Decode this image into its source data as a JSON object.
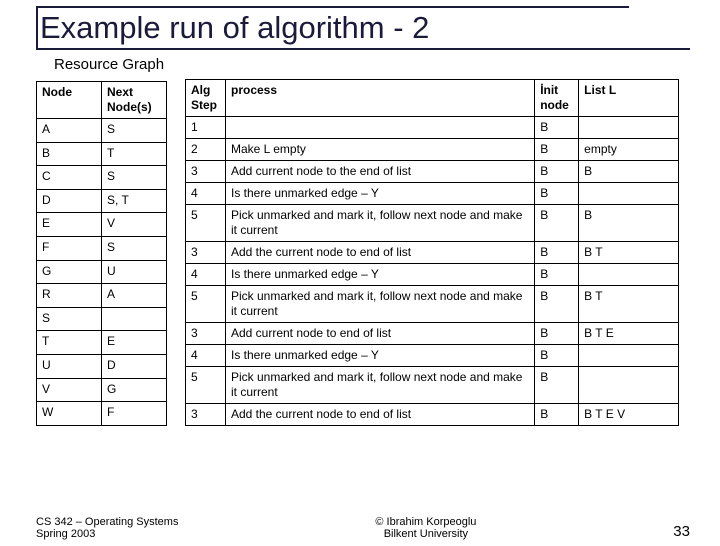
{
  "title": "Example run of algorithm - 2",
  "subtitle": "Resource Graph",
  "graph_headers": [
    "Node",
    "Next Node(s)"
  ],
  "graph_rows": [
    [
      "A",
      "S"
    ],
    [
      "B",
      "T"
    ],
    [
      "C",
      "S"
    ],
    [
      "D",
      "S, T"
    ],
    [
      "E",
      "V"
    ],
    [
      "F",
      "S"
    ],
    [
      "G",
      "U"
    ],
    [
      "R",
      "A"
    ],
    [
      "S",
      ""
    ],
    [
      "T",
      "E"
    ],
    [
      "U",
      "D"
    ],
    [
      "V",
      "G"
    ],
    [
      "W",
      "F"
    ]
  ],
  "alg_headers": [
    "Alg Step",
    "process",
    "İnit node",
    "List L"
  ],
  "alg_rows": [
    [
      "1",
      "",
      "B",
      ""
    ],
    [
      "2",
      "Make L empty",
      "B",
      "empty"
    ],
    [
      "3",
      "Add current node to the end of list",
      "B",
      "B"
    ],
    [
      "4",
      "Is there unmarked edge – Y",
      "B",
      ""
    ],
    [
      "5",
      "Pick unmarked and mark it, follow next node and make it current",
      "B",
      "B"
    ],
    [
      "3",
      "Add the current node to end of list",
      "B",
      "B T"
    ],
    [
      "4",
      "Is there unmarked edge – Y",
      "B",
      ""
    ],
    [
      "5",
      "Pick unmarked and mark it, follow next node and make it current",
      "B",
      "B T"
    ],
    [
      "3",
      "Add current node to end of list",
      "B",
      "B T E"
    ],
    [
      "4",
      "Is there unmarked edge – Y",
      "B",
      ""
    ],
    [
      "5",
      "Pick unmarked and mark it, follow next node and make it current",
      "B",
      ""
    ],
    [
      "3",
      "Add the current node to end of list",
      "B",
      "B T E V"
    ]
  ],
  "footer_left_1": "CS 342 – Operating Systems",
  "footer_left_2": "Spring 2003",
  "footer_center_1": "© Ibrahim Korpeoglu",
  "footer_center_2": "Bilkent University",
  "footer_right": "33"
}
